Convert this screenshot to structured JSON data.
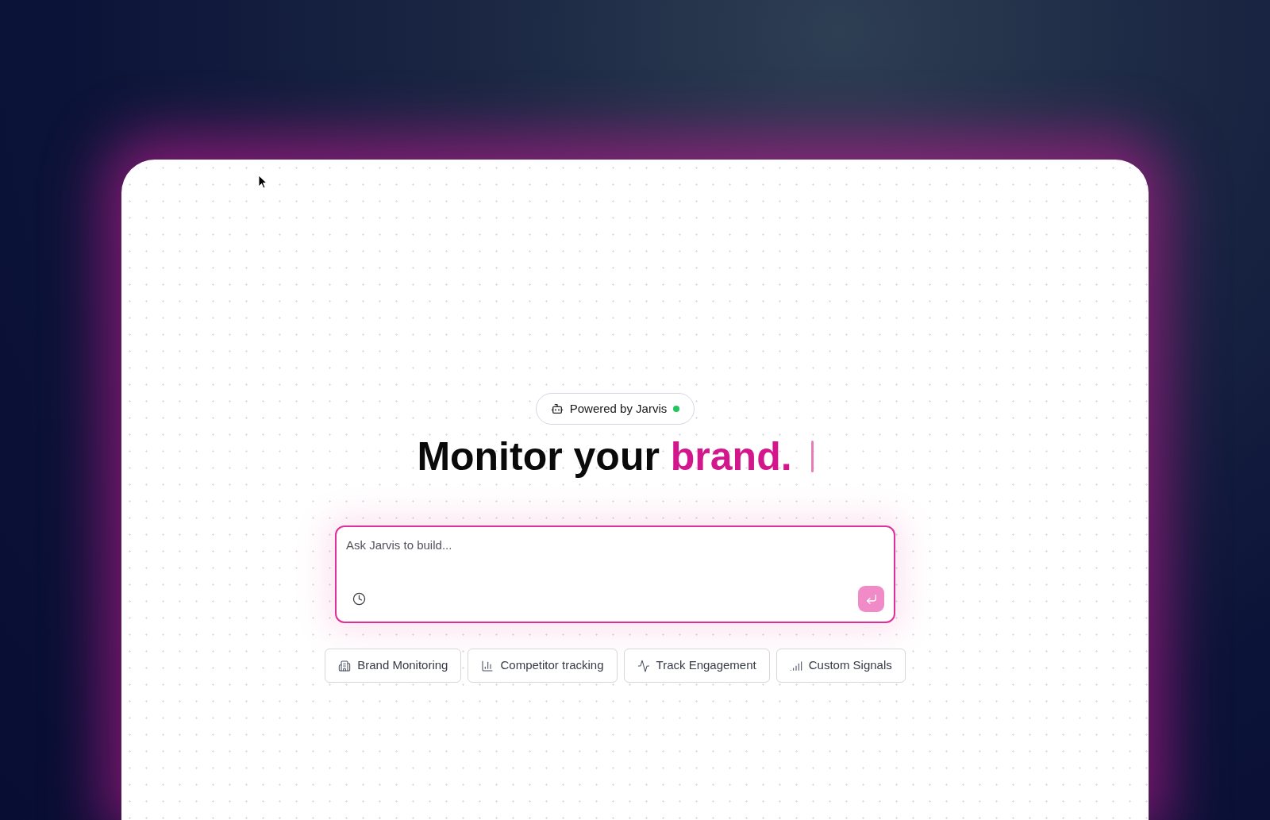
{
  "badge": {
    "label": "Powered by Jarvis",
    "online": true
  },
  "headline": {
    "lead": "Monitor your",
    "highlight": "brand.",
    "cursor_visible": true
  },
  "prompt": {
    "placeholder": "Ask Jarvis to build...",
    "send_disabled": true
  },
  "suggestions": [
    {
      "label": "Brand Monitoring"
    },
    {
      "label": "Competitor tracking"
    },
    {
      "label": "Track Engagement"
    },
    {
      "label": "Custom Signals"
    }
  ]
}
